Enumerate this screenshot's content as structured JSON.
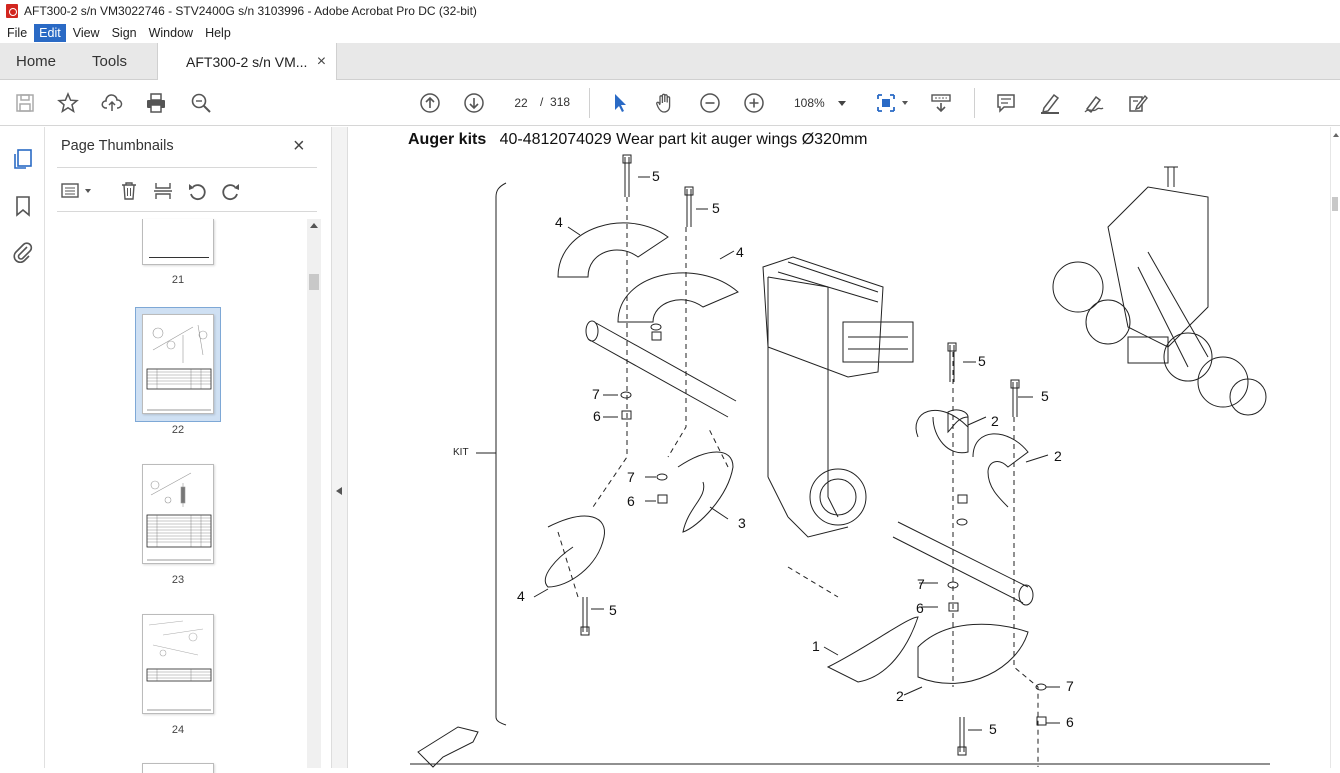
{
  "window": {
    "title": "AFT300-2  s/n VM3022746 - STV2400G s/n 3103996 - Adobe Acrobat Pro DC (32-bit)"
  },
  "menu": [
    "File",
    "Edit",
    "View",
    "Sign",
    "Window",
    "Help"
  ],
  "menu_active": "Edit",
  "tabs": {
    "home": "Home",
    "tools": "Tools",
    "document": "AFT300-2  s/n VM...",
    "close": "×"
  },
  "toolbar": {
    "page_current": "22",
    "page_sep": "/",
    "page_total": "318",
    "zoom": "108%"
  },
  "thumbnails": {
    "title": "Page Thumbnails",
    "close": "×",
    "pages": [
      {
        "label": "21",
        "selected": false
      },
      {
        "label": "22",
        "selected": true
      },
      {
        "label": "23",
        "selected": false
      },
      {
        "label": "24",
        "selected": false
      }
    ]
  },
  "document": {
    "heading_bold": "Auger kits",
    "heading_rest": "40-4812074029 Wear part kit auger wings Ø320mm",
    "kit_label": "KIT",
    "callouts": [
      "5",
      "5",
      "4",
      "4",
      "7",
      "6",
      "7",
      "6",
      "3",
      "4",
      "5",
      "5",
      "5",
      "2",
      "2",
      "7",
      "6",
      "1",
      "2",
      "7",
      "6",
      "5"
    ]
  },
  "colors": {
    "accent": "#2a6ac5",
    "selection": "#cfe0f3",
    "pdf_red": "#d2261f"
  }
}
